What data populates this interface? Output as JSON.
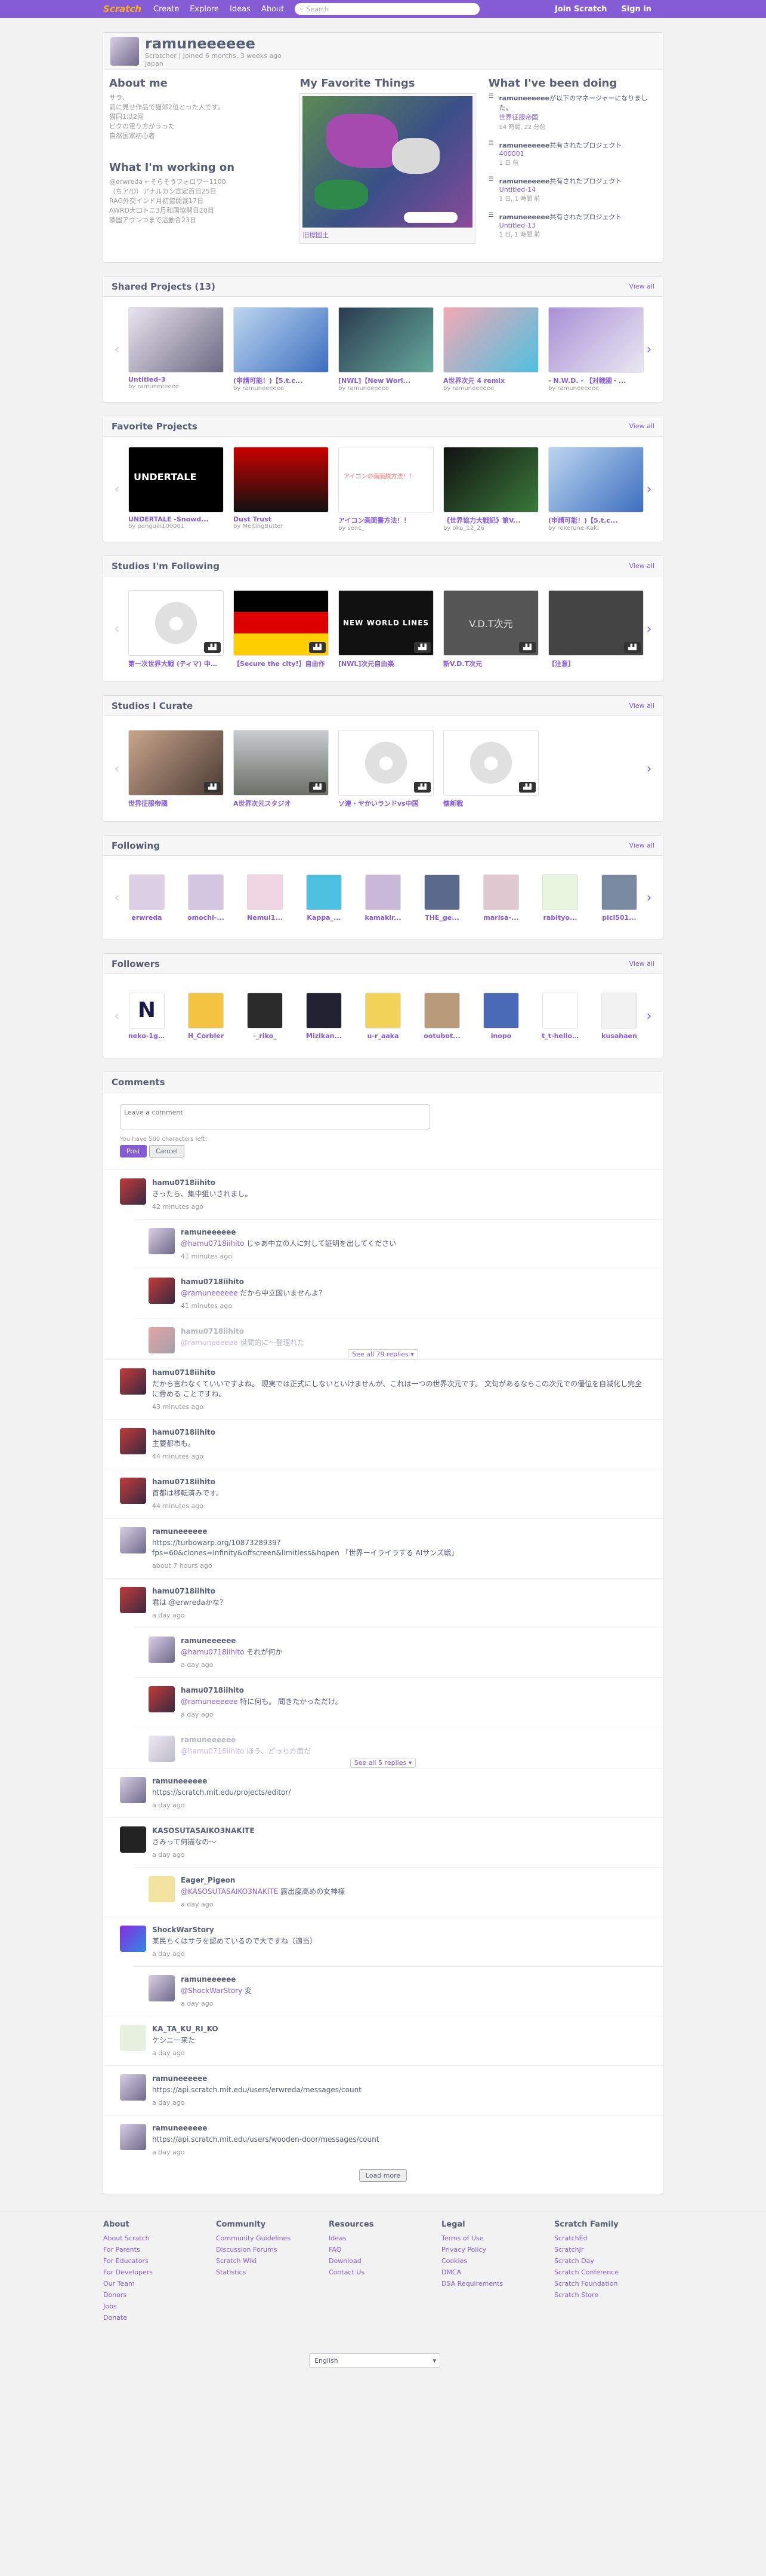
{
  "nav": {
    "logo": "Scratch",
    "create": "Create",
    "explore": "Explore",
    "ideas": "Ideas",
    "about": "About",
    "search_placeholder": "Search",
    "join": "Join Scratch",
    "signin": "Sign in"
  },
  "profile": {
    "username": "ramuneeeeee",
    "subtitle": "Scratcher | Joined 6 months, 3 weeks ago",
    "country": "Japan",
    "about_title": "About me",
    "about_text": "サラ、\n前に見せ作品で猫郊2位とった人です。\n猫同1以2回\nピクの電り方がうった\n自然国家初心者",
    "working_title": "What I'm working on",
    "working_text": "@erwreda ←そらそうフォロワー1100\n（ちア/D）アナルカン宣定百目25日\nRAG外交インド月初協開裁17日\nAWRD大口トニ3月和国協開日20目\n隣国アウンつまで活動合23日",
    "favorite_title": "My Favorite Things",
    "featured_title": "旧標国土",
    "doing_title": "What I've been doing",
    "activities": [
      {
        "who": "ramuneeeeee",
        "text": "が以下のマネージャーになりました。",
        "link": "世界征服帝国",
        "time": "14 時間, 22 分前"
      },
      {
        "who": "ramuneeeeee",
        "text": "共有されたプロジェクト",
        "link": "400001",
        "time": "1 日 前"
      },
      {
        "who": "ramuneeeeee",
        "text": "共有されたプロジェクト",
        "link": "Untitled-14",
        "time": "1 日, 1 時間 前"
      },
      {
        "who": "ramuneeeeee",
        "text": "共有されたプロジェクト",
        "link": "Untitled-13",
        "time": "1 日, 1 時間 前"
      }
    ]
  },
  "shared": {
    "title": "Shared Projects (13)",
    "view_all": "View all",
    "items": [
      {
        "title": "Untitled-3",
        "by": "by ramuneeeeee"
      },
      {
        "title": "(申請可能！)【5.t.c...",
        "by": "by ramuneeeeee"
      },
      {
        "title": "[NWL]【New Worl...",
        "by": "by ramuneeeeee"
      },
      {
        "title": "A世界次元 4 remix",
        "by": "by ramuneeeeee"
      },
      {
        "title": "- N.W.D. - 【対戦國・...",
        "by": "by ramuneeeeee"
      }
    ]
  },
  "favorites": {
    "title": "Favorite Projects",
    "view_all": "View all",
    "items": [
      {
        "title": "UNDERTALE -Snowd...",
        "by": "by penguin100001",
        "img": "UNDERTALE"
      },
      {
        "title": "Dust Trust",
        "by": "by MeltingButter",
        "img": ""
      },
      {
        "title": "アイコン画面書方法！！",
        "by": "by senc_",
        "img": "アイコンの画面説方法！！"
      },
      {
        "title": "《世界協力大戦記》第V...",
        "by": "by oku_12_26",
        "img": ""
      },
      {
        "title": "(申請可能！)【5.t.c...",
        "by": "by rokerune-Kaki",
        "img": ""
      }
    ]
  },
  "following_studios": {
    "title": "Studios I'm Following",
    "view_all": "View all",
    "items": [
      {
        "title": "第一次世界大戦 (ティマ) 中略..."
      },
      {
        "title": "【Secure the city!】自由作"
      },
      {
        "title": "[NWL]次元自由楽"
      },
      {
        "title": "新V.D.T次元"
      },
      {
        "title": "【注意】"
      }
    ],
    "nwl": "NEW WORLD LINES",
    "vdt": "V.D.T次元"
  },
  "curate": {
    "title": "Studios I Curate",
    "view_all": "View all",
    "items": [
      {
        "title": "世界征服帝國"
      },
      {
        "title": "A世界次元スタジオ"
      },
      {
        "title": "ソ連・ヤかいランドvs中国"
      },
      {
        "title": "懐新戦"
      }
    ]
  },
  "following": {
    "title": "Following",
    "view_all": "View all",
    "users": [
      "erwreda",
      "omochi-...",
      "Nemui1...",
      "Kappa_...",
      "kamakir...",
      "THE_ge...",
      "marisa-...",
      "rabityo...",
      "picl501..."
    ]
  },
  "followers": {
    "title": "Followers",
    "view_all": "View all",
    "users": [
      "neko-1g...",
      "H_Corbler",
      "-_riko_",
      "Mizikan...",
      "u-r_aaka",
      "ootubot...",
      "inopo",
      "t_t-hello...",
      "kusahaen"
    ],
    "n_letter": "N"
  },
  "comments": {
    "title": "Comments",
    "placeholder": "Leave a comment",
    "chars_left": "You have 500 characters left.",
    "post": "Post",
    "cancel": "Cancel",
    "load_more": "Load more",
    "items": [
      {
        "user": "hamu0718iihito",
        "text": "きったら、集中狙いされまし。",
        "date": "42 minutes ago",
        "replies": [
          {
            "user": "ramuneeeeee",
            "mention": "@hamu0718iihito",
            "text": " じゃあ中立の人に対して証明を出してください",
            "date": "41 minutes ago"
          },
          {
            "user": "hamu0718iihito",
            "mention": "@ramuneeeeee",
            "text": " だから中立国いませんよ？",
            "date": "41 minutes ago"
          },
          {
            "user": "hamu0718iihito",
            "mention": "@ramuneeeeee",
            "text": " 世間的に～登理れた",
            "date": ""
          }
        ],
        "more": "See all 79 replies ▾"
      },
      {
        "user": "hamu0718iihito",
        "text": "だから言わなくていいですよね。 現実では正式にしないといけませんが、これは一つの世界次元です。 文句があるならこの次元での優位を自滅化し完全に脅める ことですね。",
        "date": "43 minutes ago",
        "replies": []
      },
      {
        "user": "hamu0718iihito",
        "text": "主要都市も。",
        "date": "44 minutes ago",
        "replies": []
      },
      {
        "user": "hamu0718iihito",
        "text": "首都は移転済みです。",
        "date": "44 minutes ago",
        "replies": []
      },
      {
        "user": "ramuneeeeee",
        "text": "https://turbowarp.org/1087328939?\nfps=60&clones=Infinity&offscreen&limitless&hqpen 「世界ーイライラする AIサンズ戦」",
        "date": "about 7 hours ago",
        "replies": []
      },
      {
        "user": "hamu0718iihito",
        "text": "君は @erwredaかな？",
        "date": "a day ago",
        "replies": [
          {
            "user": "ramuneeeeee",
            "mention": "@hamu0718iihito",
            "text": " それが何か",
            "date": "a day ago"
          },
          {
            "user": "hamu0718iihito",
            "mention": "@ramuneeeeee",
            "text": " 特に何も。 聞きたかっただけ。",
            "date": "a day ago"
          },
          {
            "user": "ramuneeeeee",
            "mention": "@hamu0718iihito",
            "text": " ほう、どっち方面だ",
            "date": ""
          }
        ],
        "more": "See all 5 replies ▾"
      },
      {
        "user": "ramuneeeeee",
        "text": "https://scratch.mit.edu/projects/editor/",
        "date": "a day ago",
        "replies": []
      },
      {
        "user": "KASOSUTASAIKO3NAKITE",
        "text": "さみって何描なの～",
        "date": "a day ago",
        "replies": [
          {
            "user": "Eager_Pigeon",
            "mention": "@KASOSUTASAIKO3NAKITE",
            "text": " 露出度高めの女神様",
            "date": "a day ago"
          }
        ]
      },
      {
        "user": "ShockWarStory",
        "text": "某民ちくはサラを認めているので大ですね（適当）",
        "date": "a day ago",
        "replies": [
          {
            "user": "ramuneeeeee",
            "mention": "@ShockWarStory",
            "text": " 変",
            "date": "a day ago"
          }
        ]
      },
      {
        "user": "KA_TA_KU_RI_KO",
        "text": "ケシニー来た",
        "date": "a day ago",
        "replies": []
      },
      {
        "user": "ramuneeeeee",
        "text": "https://api.scratch.mit.edu/users/erwreda/messages/count",
        "date": "a day ago",
        "replies": []
      },
      {
        "user": "ramuneeeeee",
        "text": "https://api.scratch.mit.edu/users/wooden-door/messages/count",
        "date": "a day ago",
        "replies": []
      }
    ]
  },
  "footer": {
    "cols": [
      {
        "title": "About",
        "links": [
          "About Scratch",
          "For Parents",
          "For Educators",
          "For Developers",
          "Our Team",
          "Donors",
          "Jobs",
          "Donate"
        ]
      },
      {
        "title": "Community",
        "links": [
          "Community Guidelines",
          "Discussion Forums",
          "Scratch Wiki",
          "Statistics"
        ]
      },
      {
        "title": "Resources",
        "links": [
          "Ideas",
          "FAQ",
          "Download",
          "Contact Us"
        ]
      },
      {
        "title": "Legal",
        "links": [
          "Terms of Use",
          "Privacy Policy",
          "Cookies",
          "DMCA",
          "DSA Requirements"
        ]
      },
      {
        "title": "Scratch Family",
        "links": [
          "ScratchEd",
          "ScratchJr",
          "Scratch Day",
          "Scratch Conference",
          "Scratch Foundation",
          "Scratch Store"
        ]
      }
    ],
    "language": "English"
  },
  "colors": {
    "brand": "#855cd6",
    "text": "#575e75"
  }
}
